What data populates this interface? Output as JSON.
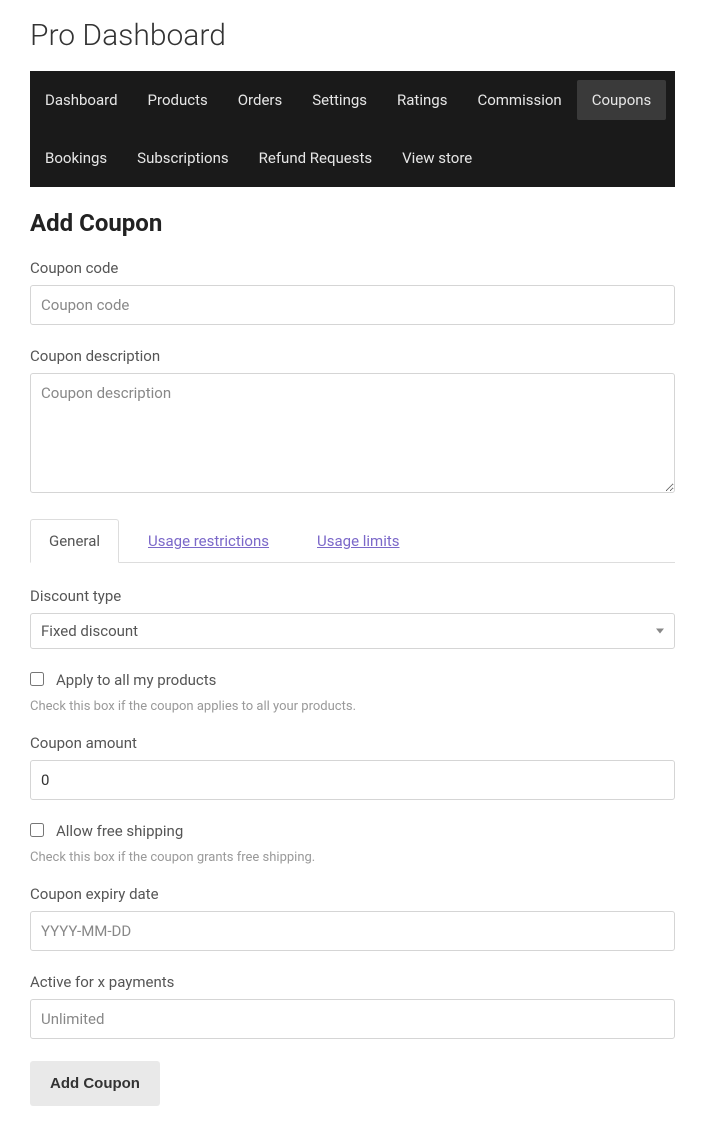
{
  "page_title": "Pro Dashboard",
  "nav": {
    "items": [
      {
        "label": "Dashboard",
        "active": false
      },
      {
        "label": "Products",
        "active": false
      },
      {
        "label": "Orders",
        "active": false
      },
      {
        "label": "Settings",
        "active": false
      },
      {
        "label": "Ratings",
        "active": false
      },
      {
        "label": "Commission",
        "active": false
      },
      {
        "label": "Coupons",
        "active": true
      },
      {
        "label": "Bookings",
        "active": false
      },
      {
        "label": "Subscriptions",
        "active": false
      },
      {
        "label": "Refund Requests",
        "active": false
      },
      {
        "label": "View store",
        "active": false
      }
    ]
  },
  "section_title": "Add Coupon",
  "fields": {
    "coupon_code": {
      "label": "Coupon code",
      "placeholder": "Coupon code",
      "value": ""
    },
    "coupon_description": {
      "label": "Coupon description",
      "placeholder": "Coupon description",
      "value": ""
    },
    "discount_type": {
      "label": "Discount type",
      "selected": "Fixed discount"
    },
    "apply_all": {
      "label": "Apply to all my products",
      "help": "Check this box if the coupon applies to all your products.",
      "checked": false
    },
    "coupon_amount": {
      "label": "Coupon amount",
      "value": "0"
    },
    "free_shipping": {
      "label": "Allow free shipping",
      "help": "Check this box if the coupon grants free shipping.",
      "checked": false
    },
    "expiry_date": {
      "label": "Coupon expiry date",
      "placeholder": "YYYY-MM-DD",
      "value": ""
    },
    "active_for": {
      "label": "Active for x payments",
      "placeholder": "Unlimited",
      "value": ""
    }
  },
  "tabs": {
    "items": [
      {
        "label": "General",
        "active": true
      },
      {
        "label": "Usage restrictions",
        "active": false
      },
      {
        "label": "Usage limits",
        "active": false
      }
    ]
  },
  "submit_label": "Add Coupon"
}
